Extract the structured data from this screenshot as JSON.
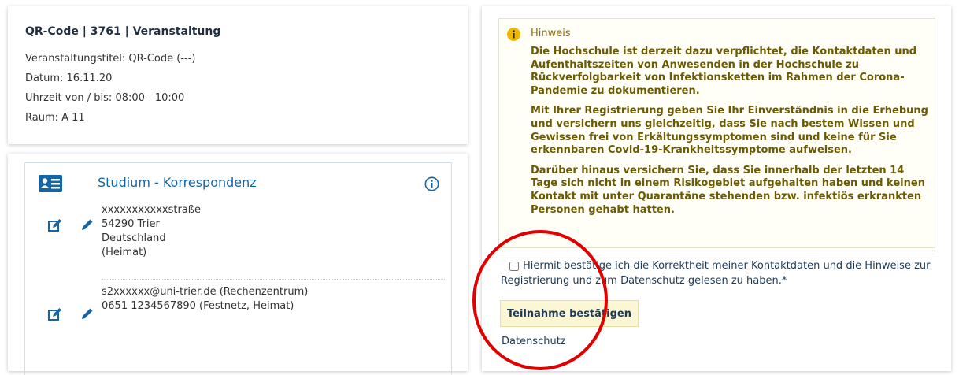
{
  "qr_card": {
    "title": "QR-Code | 3761 | Veranstaltung",
    "lines": [
      "Veranstaltungstitel: QR-Code (---)",
      "Datum: 16.11.20",
      "Uhrzeit von / bis: 08:00 - 10:00",
      "Raum: A 11"
    ]
  },
  "correspondence": {
    "title": "Studium - Korrespondenz",
    "address_lines": [
      "xxxxxxxxxxxstraße",
      "54290 Trier",
      "Deutschland",
      "(Heimat)"
    ],
    "email": "s2xxxxxx@uni-trier.de (Rechenzentrum)",
    "phone": "0651 1234567890 (Festnetz, Heimat)",
    "icons": {
      "section": "id-card-icon",
      "info": "info-circle-icon",
      "edit": "edit-box-icon",
      "pencil": "pencil-icon"
    }
  },
  "hinweis": {
    "label": "Hinweis",
    "icon": "info-circle-icon",
    "paragraphs": [
      "Die Hochschule ist derzeit dazu verpflichtet, die Kontaktdaten und Aufenthaltszeiten von Anwesenden in der Hochschule zu Rückverfolgbarkeit von Infektionsketten im Rahmen der Corona-Pandemie zu dokumentieren.",
      "Mit Ihrer Registrierung geben Sie Ihr Einverständnis in die Erhebung und versichern uns gleichzeitig, dass Sie nach bestem Wissen und Gewissen frei von Erkältungssymptomen sind und keine für Sie erkennbaren Covid-19-Krankheitssymptome aufweisen.",
      "Darüber hinaus versichern Sie, dass Sie innerhalb der letzten 14 Tage sich nicht in einem Risikogebiet aufgehalten haben und keinen Kontakt mit unter Quarantäne stehenden bzw. infektiös erkrankten Personen gehabt hatten."
    ]
  },
  "consent": {
    "text": "Hiermit bestätige ich die Korrektheit meiner Kontaktdaten und die Hinweise zur Registrierung und zum Datenschutz gelesen zu haben.*",
    "checked": false
  },
  "confirm_button": {
    "label": "Teilnahme bestätigen"
  },
  "privacy_link": {
    "label": "Datenschutz"
  },
  "colors": {
    "accent": "#1565a6",
    "hinweis_text": "#6b5a00",
    "button_bg": "#fbf6d3",
    "annotation": "#e00000"
  }
}
